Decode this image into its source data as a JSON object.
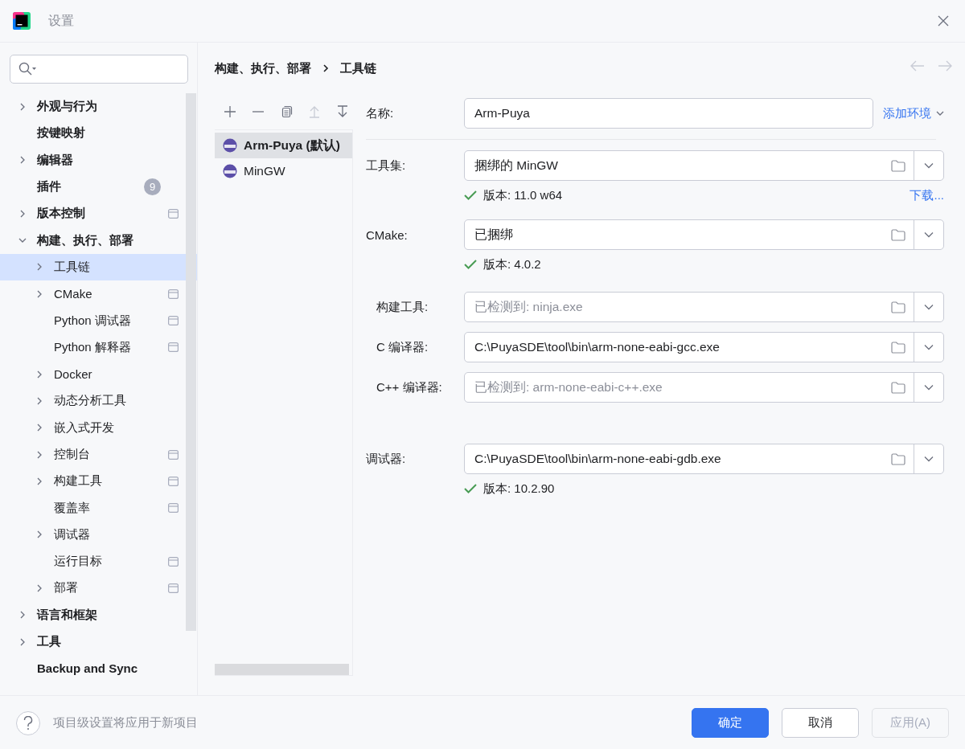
{
  "window": {
    "title": "设置"
  },
  "sidebar": {
    "items": [
      {
        "label": "外观与行为",
        "kind": "group",
        "expanded": false,
        "selected": false,
        "project_level": false
      },
      {
        "label": "按键映射",
        "kind": "leaf",
        "selected": false,
        "project_level": false
      },
      {
        "label": "编辑器",
        "kind": "group",
        "expanded": false,
        "selected": false,
        "project_level": false
      },
      {
        "label": "插件",
        "kind": "leaf",
        "selected": false,
        "project_level": false,
        "badge": "9"
      },
      {
        "label": "版本控制",
        "kind": "group",
        "expanded": false,
        "selected": false,
        "project_level": true
      },
      {
        "label": "构建、执行、部署",
        "kind": "group",
        "expanded": true,
        "selected": false,
        "project_level": false,
        "children": [
          {
            "label": "工具链",
            "kind": "group",
            "expanded": false,
            "selected": true,
            "project_level": false
          },
          {
            "label": "CMake",
            "kind": "group",
            "expanded": false,
            "selected": false,
            "project_level": true
          },
          {
            "label": "Python 调试器",
            "kind": "leaf",
            "selected": false,
            "project_level": true
          },
          {
            "label": "Python 解释器",
            "kind": "leaf",
            "selected": false,
            "project_level": true
          },
          {
            "label": "Docker",
            "kind": "group",
            "expanded": false,
            "selected": false,
            "project_level": false
          },
          {
            "label": "动态分析工具",
            "kind": "group",
            "expanded": false,
            "selected": false,
            "project_level": false
          },
          {
            "label": "嵌入式开发",
            "kind": "group",
            "expanded": false,
            "selected": false,
            "project_level": false
          },
          {
            "label": "控制台",
            "kind": "group",
            "expanded": false,
            "selected": false,
            "project_level": true
          },
          {
            "label": "构建工具",
            "kind": "group",
            "expanded": false,
            "selected": false,
            "project_level": true
          },
          {
            "label": "覆盖率",
            "kind": "leaf",
            "selected": false,
            "project_level": true
          },
          {
            "label": "调试器",
            "kind": "group",
            "expanded": false,
            "selected": false,
            "project_level": false
          },
          {
            "label": "运行目标",
            "kind": "leaf",
            "selected": false,
            "project_level": true
          },
          {
            "label": "部署",
            "kind": "group",
            "expanded": false,
            "selected": false,
            "project_level": true
          }
        ]
      },
      {
        "label": "语言和框架",
        "kind": "group",
        "expanded": false,
        "selected": false,
        "project_level": false
      },
      {
        "label": "工具",
        "kind": "group",
        "expanded": false,
        "selected": false,
        "project_level": false
      },
      {
        "label": "Backup and Sync",
        "kind": "leaf",
        "selected": false,
        "project_level": false
      }
    ]
  },
  "breadcrumb": [
    "构建、执行、部署",
    "工具链"
  ],
  "toolbar": [
    {
      "kind": "add",
      "disabled": false
    },
    {
      "kind": "remove",
      "disabled": false
    },
    {
      "kind": "copy",
      "disabled": false
    },
    {
      "kind": "up",
      "disabled": true
    },
    {
      "kind": "down",
      "disabled": false
    }
  ],
  "toolchains": [
    {
      "name": "Arm-Puya (默认)",
      "selected": true
    },
    {
      "name": "MinGW",
      "selected": false
    }
  ],
  "name_field": {
    "label": "名称:",
    "value": "Arm-Puya",
    "link": "添加环境"
  },
  "fields": [
    {
      "label": "工具集:",
      "value": "捆绑的 MinGW",
      "indented": false,
      "status": "版本: 11.0 w64",
      "link": "下载..."
    },
    {
      "label": "CMake:",
      "value": "已捆绑",
      "indented": false,
      "status": "版本: 4.0.2"
    },
    {
      "label": "构建工具:",
      "placeholder": "已检测到: ninja.exe",
      "indented": true
    },
    {
      "label": "C 编译器:",
      "value": "C:\\PuyaSDE\\tool\\bin\\arm-none-eabi-gcc.exe",
      "indented": true
    },
    {
      "label": "C++ 编译器:",
      "placeholder": "已检测到: arm-none-eabi-c++.exe",
      "indented": true
    },
    {
      "label": "调试器:",
      "value": "C:\\PuyaSDE\\tool\\bin\\arm-none-eabi-gdb.exe",
      "indented": false,
      "status": "版本: 10.2.90"
    }
  ],
  "footer": {
    "hint": "项目级设置将应用于新项目",
    "buttons": [
      {
        "label": "确定",
        "kind": "primary",
        "disabled": false
      },
      {
        "label": "取消",
        "kind": "normal",
        "disabled": false
      },
      {
        "label": "应用(A)",
        "kind": "normal",
        "disabled": true
      }
    ]
  }
}
